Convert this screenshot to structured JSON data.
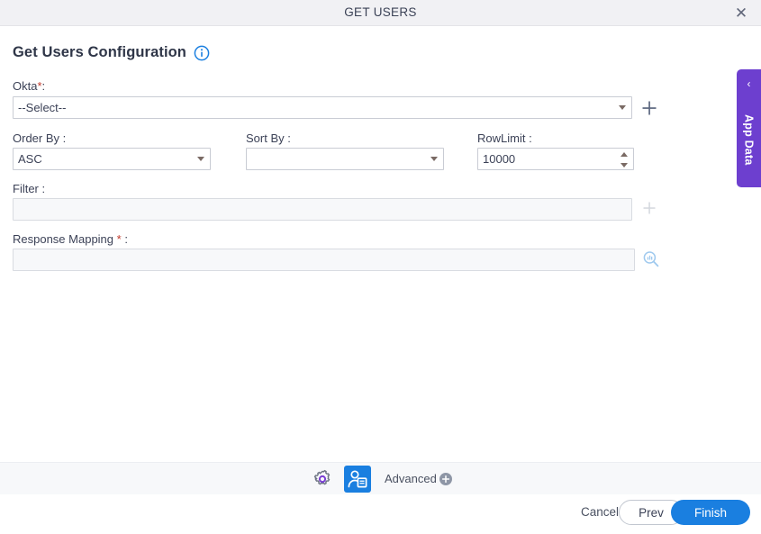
{
  "window": {
    "title": "GET USERS",
    "close_label": "✕"
  },
  "page": {
    "heading": "Get Users Configuration",
    "info_icon": "info-circle-icon"
  },
  "side_tab": {
    "label": "App Data",
    "chevron": "‹",
    "color": "#6d3fcf"
  },
  "form": {
    "okta": {
      "label": "Okta",
      "required_mark": "*",
      "colon": ":",
      "value": "--Select--",
      "add_icon": "plus-icon"
    },
    "order_by": {
      "label": "Order By :",
      "value": "ASC"
    },
    "sort_by": {
      "label": "Sort By :",
      "value": ""
    },
    "row_limit": {
      "label": "RowLimit :",
      "value": "10000"
    },
    "filter": {
      "label": "Filter :",
      "value": "",
      "add_icon": "plus-icon"
    },
    "response_mapping": {
      "label": "Response Mapping",
      "required_mark": "*",
      "colon": ":",
      "value": "",
      "search_icon": "data-mapping-search-icon"
    }
  },
  "toolbar": {
    "gear_icon": "settings-gear-icon",
    "user_icon": "user-record-icon",
    "advanced_label": "Advanced",
    "advanced_plus_icon": "plus-circle-icon"
  },
  "footer": {
    "cancel_label": "Cancel",
    "prev_label": "Prev",
    "finish_label": "Finish"
  },
  "colors": {
    "accent_blue": "#1a7fe0",
    "accent_purple": "#6d3fcf",
    "required_red": "#c0392b"
  }
}
